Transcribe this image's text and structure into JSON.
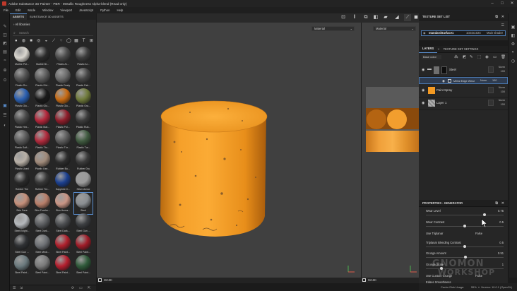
{
  "window": {
    "title": "Adobe Substance 3D Painter - PBR - Metallic Roughness Alpha-blend (Read only)",
    "controls": {
      "minimize": "–",
      "maximize": "□",
      "close": "✕"
    }
  },
  "menu": [
    "File",
    "Edit",
    "Mode",
    "Window",
    "Viewport",
    "JavaScript",
    "Python",
    "Help"
  ],
  "assets": {
    "tabs": [
      "ASSETS",
      "SUBSTANCE 3D ASSETS"
    ],
    "libraries_label": "All libraries",
    "search_placeholder": "Search",
    "materials": [
      {
        "label": "Marble Pol...",
        "color": "#d9d6cf"
      },
      {
        "label": "Marble Bl...",
        "color": "#2b2b2b"
      },
      {
        "label": "Plastic Ar...",
        "color": "#4a4a4a"
      },
      {
        "label": "Plastic Ar...",
        "color": "#3c3c3c"
      },
      {
        "label": "Plastic Ru...",
        "color": "#505050"
      },
      {
        "label": "Plastic Dirt...",
        "color": "#5a5a5a"
      },
      {
        "label": "Plastic Dusty",
        "color": "#6a6a6a"
      },
      {
        "label": "Plastic Fab...",
        "color": "#454545"
      },
      {
        "label": "Plastic Glo...",
        "color": "#2a5fb0"
      },
      {
        "label": "Plastic Glo...",
        "color": "#1a1a1a"
      },
      {
        "label": "Plastic Glo...",
        "color": "#c76a12"
      },
      {
        "label": "Plastic Gra...",
        "color": "#6f7a3a"
      },
      {
        "label": "Plastic Hex...",
        "color": "#484848"
      },
      {
        "label": "Plastic Mat...",
        "color": "#b3263a"
      },
      {
        "label": "Plastic Pol...",
        "color": "#8f1d2a"
      },
      {
        "label": "Plastic Rub...",
        "color": "#3b3b3b"
      },
      {
        "label": "Plastic Soft...",
        "color": "#595959"
      },
      {
        "label": "Plastic Thr...",
        "color": "#b02a3c"
      },
      {
        "label": "Plastic Thr...",
        "color": "#5b5b5b"
      },
      {
        "label": "Plastic Tur...",
        "color": "#3f5a3f"
      },
      {
        "label": "Plastic Used",
        "color": "#b8b0a6"
      },
      {
        "label": "Plastic Use...",
        "color": "#a08a7a"
      },
      {
        "label": "Rubber Bu...",
        "color": "#2d2d2d"
      },
      {
        "label": "Rubber Dry",
        "color": "#3a3a3a"
      },
      {
        "label": "Rubber Tire",
        "color": "#2a2a2a"
      },
      {
        "label": "Rubber Tre...",
        "color": "#363636"
      },
      {
        "label": "Sapphire C...",
        "color": "#1b3f8f"
      },
      {
        "label": "Silver Armor",
        "color": "#9a9a9a"
      },
      {
        "label": "Skin Face",
        "color": "#c58f7a"
      },
      {
        "label": "Skin Forehe...",
        "color": "#b97f6a"
      },
      {
        "label": "Skin Huma...",
        "color": "#c99585"
      },
      {
        "label": "Steel",
        "color": "#8a8e92"
      },
      {
        "label": "Steel Bright...",
        "color": "#b5b8bc"
      },
      {
        "label": "Steel Dark...",
        "color": "#5c5e61"
      },
      {
        "label": "Steel Dark...",
        "color": "#4d4f52"
      },
      {
        "label": "Steel Gun ...",
        "color": "#3d3f42"
      },
      {
        "label": "Steel Gun ...",
        "color": "#2f3134"
      },
      {
        "label": "Steel Medi...",
        "color": "#6e7175"
      },
      {
        "label": "Steel Paint...",
        "color": "#b0202c"
      },
      {
        "label": "Steel Paint...",
        "color": "#a01c28"
      },
      {
        "label": "Steel Paint...",
        "color": "#6b7a7e"
      },
      {
        "label": "Steel Paint...",
        "color": "#7a7a7a"
      },
      {
        "label": "Steel Paint...",
        "color": "#b51f2e"
      },
      {
        "label": "Steel Paint...",
        "color": "#2f5a3a"
      }
    ],
    "selected_index": 31
  },
  "viewport": {
    "left_mode": "Material",
    "right_mode": "Material",
    "left_mask": "MASK",
    "right_mask": "MASK",
    "object_color": "#f39a23"
  },
  "texture_set_list": {
    "title": "TEXTURE SET LIST",
    "set_name": "standardSurface1",
    "resolution": "1024x1024",
    "shader": "Main shader"
  },
  "layers_panel": {
    "tabs": [
      "LAYERS",
      "TEXTURE SET SETTINGS"
    ],
    "channel": "Base color",
    "layers": [
      {
        "name": "Steel",
        "blend": "Norm",
        "opacity": "100",
        "thumb": "#707070"
      },
      {
        "name": "Metal Edge Wear",
        "blend": "Norm",
        "opacity": "100",
        "thumb": "#1a1a1a"
      },
      {
        "name": "Paint Spray",
        "blend": "Norm",
        "opacity": "100",
        "thumb": "#f39a23"
      },
      {
        "name": "Layer 1",
        "blend": "Norm",
        "opacity": "100",
        "thumb": "#9a9a9a"
      }
    ]
  },
  "properties": {
    "title": "PROPERTIES - GENERATOR",
    "items": [
      {
        "label": "Wear Level",
        "value": "0.75",
        "type": "slider",
        "fraction": 0.75
      },
      {
        "label": "Wear Contrast",
        "value": "0.5",
        "type": "slider",
        "fraction": 0.5
      },
      {
        "label": "Use Triplanar",
        "value": "False",
        "type": "bool"
      },
      {
        "label": "Triplanar Blending Contrast",
        "value": "0.5",
        "type": "slider",
        "fraction": 0.5
      },
      {
        "label": "Grunge Amount",
        "value": "0.51",
        "type": "slider",
        "fraction": 0.51
      },
      {
        "label": "Grunge Scale",
        "value": "1",
        "type": "slider",
        "fraction": 0.2
      },
      {
        "label": "Use Custom Grunge",
        "value": "False",
        "type": "bool"
      },
      {
        "label": "Edges Smoothness",
        "value": "",
        "type": "text"
      }
    ]
  },
  "status": {
    "cache": "Cache Disk Usage:",
    "usage": "55%",
    "version": "Version: 10.0.1 (OpenGL)"
  },
  "watermark": {
    "line1": "GNOMON",
    "line2": "WORKSHOP"
  }
}
